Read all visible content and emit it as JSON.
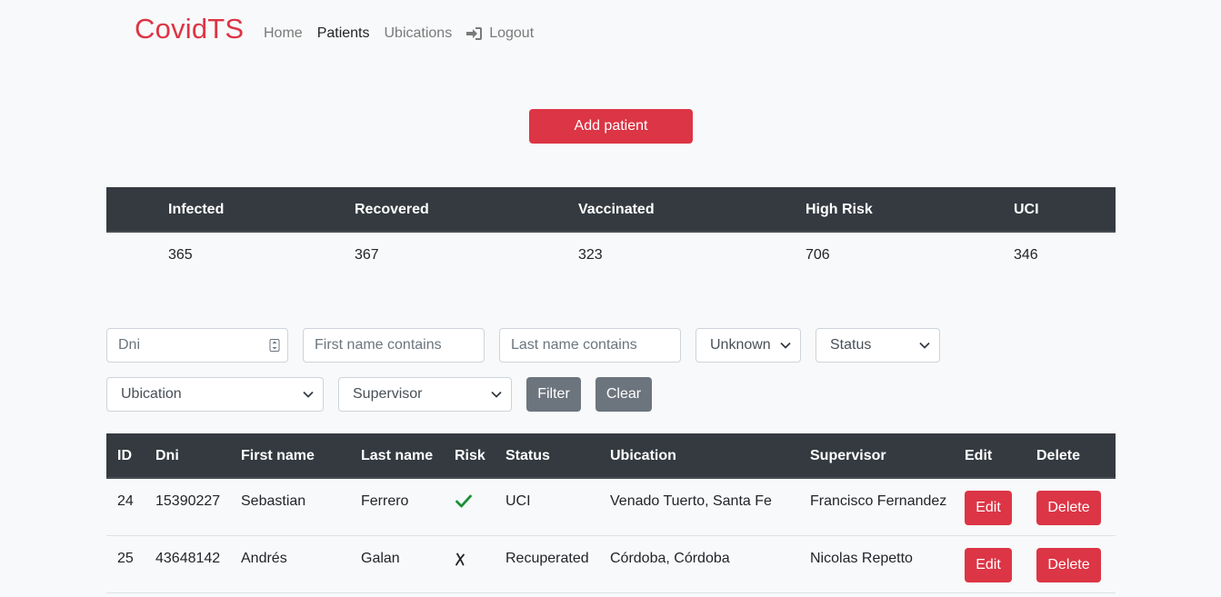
{
  "brand": "CovidTS",
  "nav": {
    "home": "Home",
    "patients": "Patients",
    "ubications": "Ubications",
    "logout": "Logout"
  },
  "add_patient": "Add patient",
  "stats": {
    "headers": [
      "Infected",
      "Recovered",
      "Vaccinated",
      "High Risk",
      "UCI"
    ],
    "values": [
      "365",
      "367",
      "323",
      "706",
      "346"
    ]
  },
  "filters": {
    "dni_placeholder": "Dni",
    "first_name_placeholder": "First name contains",
    "last_name_placeholder": "Last name contains",
    "risk_select": "Unknown",
    "status_select": "Status",
    "ubication_select": "Ubication",
    "supervisor_select": "Supervisor",
    "filter_button": "Filter",
    "clear_button": "Clear"
  },
  "table": {
    "headers": [
      "ID",
      "Dni",
      "First name",
      "Last name",
      "Risk",
      "Status",
      "Ubication",
      "Supervisor",
      "Edit",
      "Delete"
    ],
    "rows": [
      {
        "id": "24",
        "dni": "15390227",
        "first_name": "Sebastian",
        "last_name": "Ferrero",
        "risk": "check",
        "status": "UCI",
        "ubication": "Venado Tuerto, Santa Fe",
        "supervisor": "Francisco Fernandez",
        "edit": "Edit",
        "delete": "Delete"
      },
      {
        "id": "25",
        "dni": "43648142",
        "first_name": "Andrés",
        "last_name": "Galan",
        "risk": "cross",
        "status": "Recuperated",
        "ubication": "Córdoba, Córdoba",
        "supervisor": "Nicolas Repetto",
        "edit": "Edit",
        "delete": "Delete"
      }
    ]
  },
  "colors": {
    "accent": "#dc3545",
    "dark": "#343a40",
    "gray_button": "#6c757d",
    "check": "#28a745"
  }
}
